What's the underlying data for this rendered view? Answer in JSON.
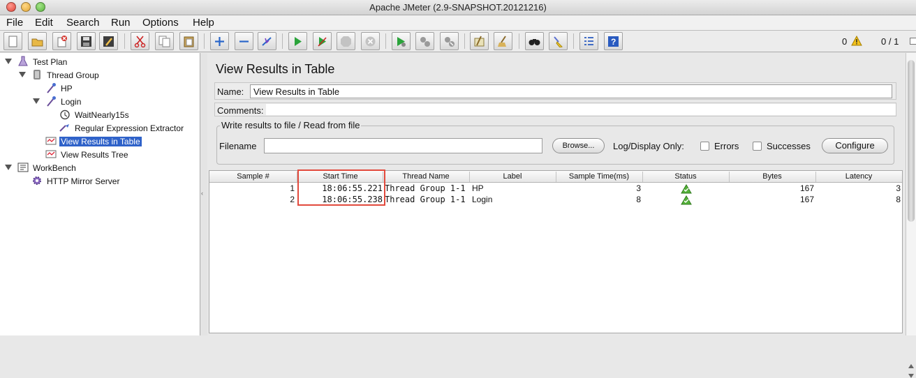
{
  "window": {
    "title": "Apache JMeter (2.9-SNAPSHOT.20121216)"
  },
  "menu": [
    "File",
    "Edit",
    "Search",
    "Run",
    "Options",
    "Help"
  ],
  "toolbar": {
    "icons": [
      "new-icon",
      "open-icon",
      "close-icon",
      "save-icon",
      "save-as-icon",
      "cut-icon",
      "copy-icon",
      "paste-icon",
      "expand-icon",
      "collapse-icon",
      "toggle-icon",
      "start-icon",
      "start-no-pause-icon",
      "stop-icon",
      "shutdown-icon",
      "remote-start-icon",
      "remote-stop-icon",
      "remote-shutdown-icon",
      "clear-icon",
      "clear-all-icon",
      "search-icon",
      "reset-search-icon",
      "function-helper-icon",
      "help-icon"
    ],
    "error_count": "0",
    "threads": "0 / 1"
  },
  "tree": {
    "nodes": [
      {
        "label": "Test Plan",
        "icon": "test-plan-icon",
        "expanded": true,
        "selected": false
      },
      {
        "label": "Thread Group",
        "icon": "thread-group-icon",
        "expanded": true,
        "selected": false
      },
      {
        "label": "HP",
        "icon": "sampler-icon",
        "selected": false
      },
      {
        "label": "Login",
        "icon": "sampler-icon",
        "expanded": true,
        "selected": false
      },
      {
        "label": "WaitNearly15s",
        "icon": "timer-icon",
        "selected": false
      },
      {
        "label": "Regular Expression Extractor",
        "icon": "extractor-icon",
        "selected": false
      },
      {
        "label": "View Results in Table",
        "icon": "listener-icon",
        "selected": true
      },
      {
        "label": "View Results Tree",
        "icon": "listener-icon",
        "selected": false
      },
      {
        "label": "WorkBench",
        "icon": "workbench-icon",
        "expanded": true,
        "selected": false
      },
      {
        "label": "HTTP Mirror Server",
        "icon": "gear-icon",
        "selected": false
      }
    ]
  },
  "panel": {
    "title": "View Results in Table",
    "name_label": "Name:",
    "name_value": "View Results in Table",
    "comments_label": "Comments:",
    "fileset_legend": "Write results to file / Read from file",
    "filename_label": "Filename",
    "filename_value": "",
    "browse_label": "Browse...",
    "log_display_label": "Log/Display Only:",
    "errors_label": "Errors",
    "successes_label": "Successes",
    "configure_label": "Configure"
  },
  "table": {
    "columns": [
      "Sample #",
      "Start Time",
      "Thread Name",
      "Label",
      "Sample Time(ms)",
      "Status",
      "Bytes",
      "Latency"
    ],
    "rows": [
      {
        "sample": "1",
        "start_time": "18:06:55.221",
        "thread": "Thread Group 1-1",
        "label": "HP",
        "sample_time": "3",
        "status": "success-icon",
        "bytes": "167",
        "latency": "3"
      },
      {
        "sample": "2",
        "start_time": "18:06:55.238",
        "thread": "Thread Group 1-1",
        "label": "Login",
        "sample_time": "8",
        "status": "success-icon",
        "bytes": "167",
        "latency": "8"
      }
    ]
  },
  "colors": {
    "selection": "#2f62c9",
    "highlight": "#e24a3d",
    "status_ok": "#4a9a2a"
  }
}
